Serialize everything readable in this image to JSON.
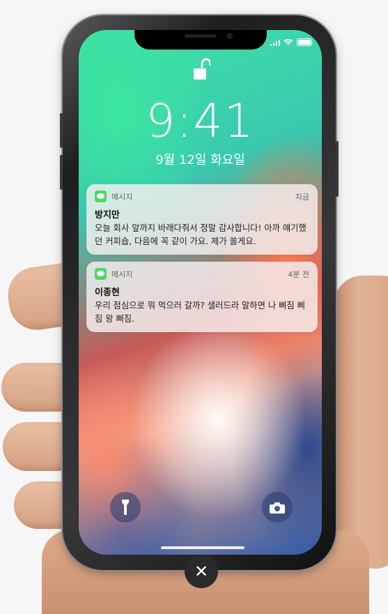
{
  "lock_screen": {
    "time": "9:41",
    "date": "9월 12일 화요일"
  },
  "notifications": [
    {
      "app": "메시지",
      "when": "지금",
      "sender": "방지만",
      "message": "오늘 회사 앞까지 바래다줘서 정말 감사합니다! 아까 얘기했던 커피숍, 다음에 꼭 같이 가요. 제가 쏠게요."
    },
    {
      "app": "메시지",
      "when": "4분 전",
      "sender": "이종현",
      "message": "우리 점심으로 뭐 먹으러 갈까? 샐러드라 말하면 나 삐짐 삐짐 왕 삐짐."
    }
  ],
  "icons": {
    "lock": "unlocked-padlock-icon",
    "flashlight": "flashlight-icon",
    "camera": "camera-icon",
    "close": "close-icon"
  },
  "close_glyph": "✕"
}
